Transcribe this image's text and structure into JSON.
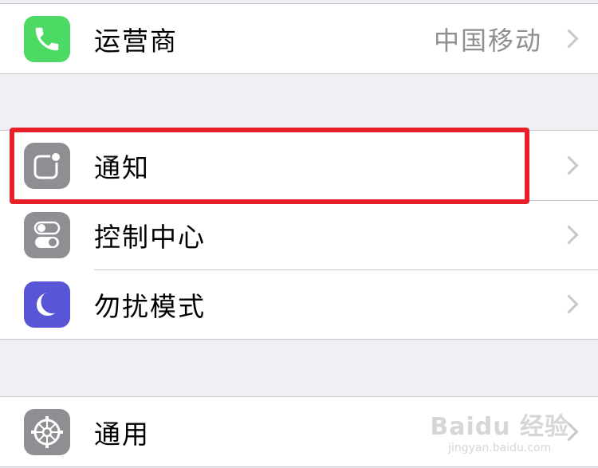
{
  "rows": {
    "carrier": {
      "label": "运营商",
      "detail": "中国移动",
      "icon": "phone-icon",
      "color": "#4cd964"
    },
    "notifications": {
      "label": "通知",
      "icon": "notifications-icon",
      "color": "#8e8e93"
    },
    "control_center": {
      "label": "控制中心",
      "icon": "control-center-icon",
      "color": "#8e8e93"
    },
    "do_not_disturb": {
      "label": "勿扰模式",
      "icon": "moon-icon",
      "color": "#5856d6"
    },
    "general": {
      "label": "通用",
      "icon": "gear-icon",
      "color": "#8e8e93"
    }
  },
  "highlight_color": "#e8202a",
  "watermark": {
    "main": "Baidu 经验",
    "sub": "jingyan.baidu.com"
  }
}
